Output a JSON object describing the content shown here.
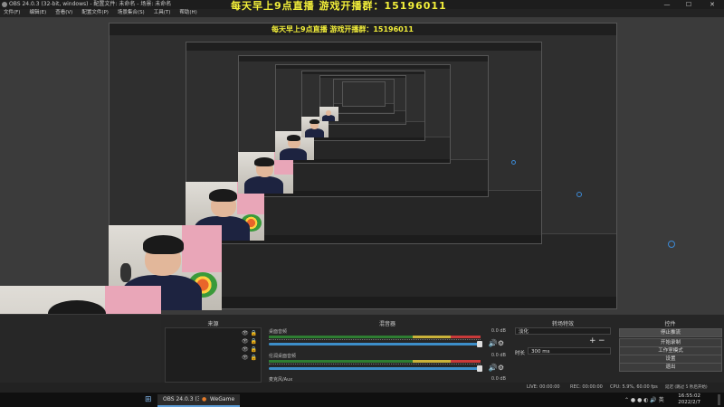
{
  "window": {
    "title": "OBS 24.0.3 (32-bit, windows) - 配置文件: 未命名 - 场景: 未命名",
    "controls": [
      "—",
      "☐",
      "✕"
    ]
  },
  "menu": [
    "文件(F)",
    "编辑(E)",
    "查看(V)",
    "配置文件(P)",
    "场景集合(S)",
    "工具(T)",
    "帮助(H)"
  ],
  "overlay_text": "每天早上9点直播  游戏开播群：15196011",
  "nested_overlay_text": "每天早上9点直播  游戏开播群：15196011",
  "docks": {
    "sources": {
      "title": "来源",
      "add": "+",
      "remove": "−",
      "up": "⌃",
      "down": "⌄",
      "rows": [
        "",
        "",
        "",
        ""
      ]
    },
    "mixer": {
      "title": "混音器",
      "channels": [
        {
          "name": "桌面音频",
          "db": "0.0 dB"
        },
        {
          "name": "伦润桌面音频",
          "db": "0.0 dB"
        },
        {
          "name": "麦克风/Aux",
          "db": "0.0 dB"
        }
      ]
    },
    "transitions": {
      "title": "转场特效",
      "type": "淡化",
      "duration_label": "时长",
      "duration_value": "300 ms",
      "add": "+",
      "remove": "−"
    },
    "controls": {
      "title": "控件",
      "buttons": [
        "停止推流",
        "开始录制",
        "工作室模式",
        "设置",
        "退出"
      ]
    }
  },
  "status": {
    "live": "LIVE: 00:00:00",
    "rec": "REC: 00:00:00",
    "cpu": "CPU: 5.9%, 60.00 fps",
    "delay": "延迟 (跳过 5 秒后开始)"
  },
  "taskbar": {
    "items": [
      "OBS 24.0.3 (32-bit...",
      "WeGame"
    ],
    "time": "16:55:02",
    "date": "2022/2/7"
  }
}
